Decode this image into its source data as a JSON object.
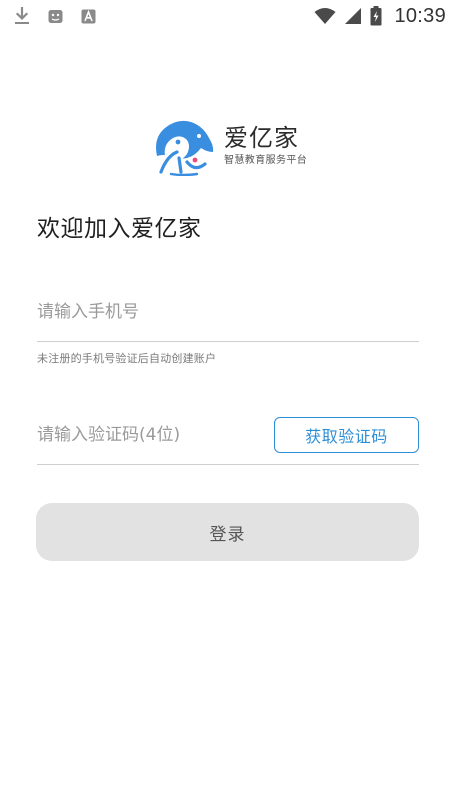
{
  "status_bar": {
    "time": "10:39",
    "left_icons": [
      "download-icon",
      "notification-app-icon",
      "accessibility-a-icon"
    ],
    "right_icons": [
      "wifi-icon",
      "signal-icon",
      "battery-charging-icon"
    ]
  },
  "logo": {
    "title": "爱亿家",
    "subtitle": "智慧教育服务平台",
    "color": "#3a8ee0"
  },
  "welcome": {
    "title": "欢迎加入爱亿家"
  },
  "phone": {
    "placeholder": "请输入手机号",
    "value": "",
    "hint": "未注册的手机号验证后自动创建账户"
  },
  "code": {
    "placeholder": "请输入验证码(4位)",
    "value": "",
    "get_code_label": "获取验证码"
  },
  "login": {
    "label": "登录"
  },
  "colors": {
    "accent": "#2f8fd6",
    "button_disabled_bg": "#e2e2e2",
    "divider": "#cfcfcf"
  }
}
